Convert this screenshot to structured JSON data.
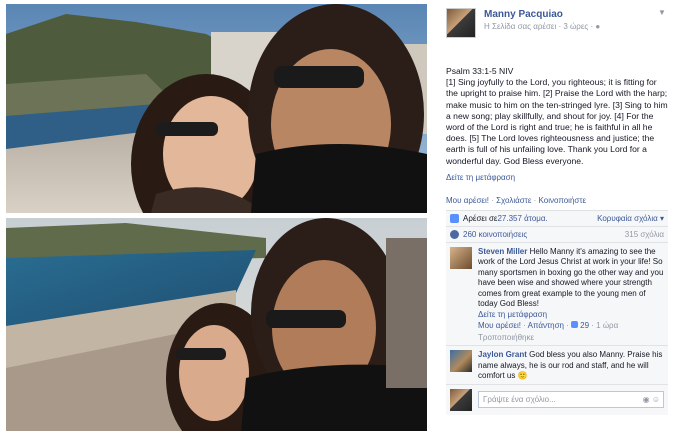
{
  "page": {
    "author": "Manny Pacquiao",
    "meta": "Η Σελίδα σας αρέσει · 3 ώρες · ",
    "privacy_icon": "globe-icon",
    "menu_icon": "chevron-down-icon"
  },
  "post": {
    "lines": [
      "Psalm 33:1-5 NIV",
      "[1] Sing joyfully to the Lord, you righteous; it is fitting for the upright to praise him. [2] Praise the Lord with the harp; make music to him on the ten-stringed lyre. [3] Sing to him a new song; play skillfully, and shout for joy. [4] For the word of the Lord is right and true; he is faithful in all he does. [5] The Lord loves righteousness and justice; the earth is full of his unfailing love. Thank you Lord for a wonderful day. God Bless everyone."
    ],
    "see_translation": "Δείτε τη μετάφραση"
  },
  "actions": {
    "like": "Μου αρέσει!",
    "comment": "Σχολιάστε",
    "share": "Κοινοποιήστε"
  },
  "stats": {
    "likes_prefix": "Αρέσει σε ",
    "likes_count": "27.357 άτομα.",
    "top_comments": "Κορυφαία σχόλια",
    "shares": "260 κοινοποιήσεις",
    "comments_count": "315 σχόλια"
  },
  "comments": [
    {
      "name": "Steven Miller",
      "text": "Hello Manny it's amazing to see the work of the Lord Jesus Christ at work in your life! So many sportsmen in boxing go the other way and you have been wise and showed where your strength comes from great example to the young men of today God Bless!",
      "translate": "Δείτε τη μετάφραση",
      "like": "Μου αρέσει!",
      "reply": "Απάντηση",
      "likes": "29",
      "time": "1 ώρα",
      "edited": "Τροποποιήθηκε"
    },
    {
      "name": "Jaylon Grant",
      "text": "God bless you also Manny. Praise his name always, he is our rod and staff, and he will comfort us ",
      "smile": "🙂"
    }
  ],
  "composer": {
    "placeholder": "Γράψτε ένα σχόλιο...",
    "camera_icon": "camera-icon",
    "emoji_icon": "emoji-icon"
  },
  "colors": {
    "link": "#3b5998",
    "muted": "#9197a3",
    "panel": "#f6f7f9"
  }
}
